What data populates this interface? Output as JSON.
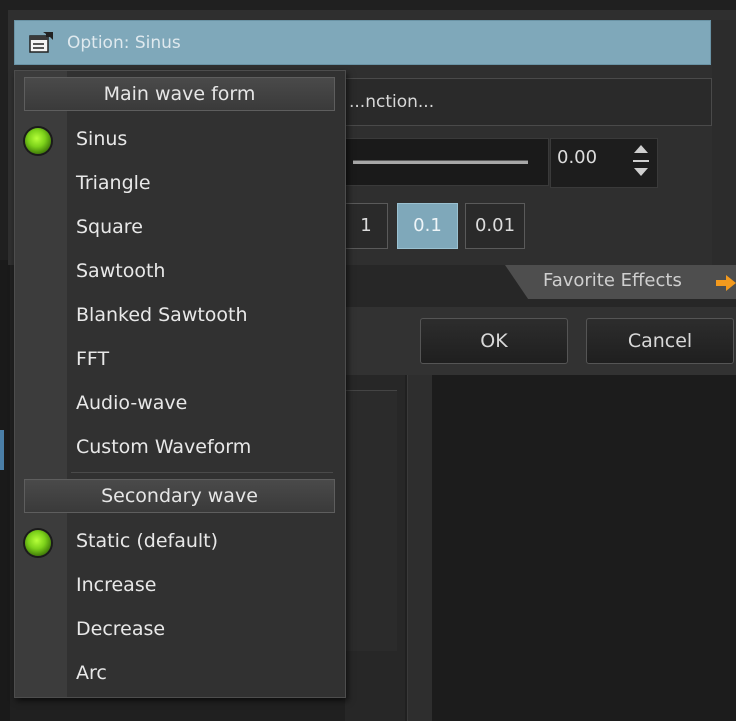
{
  "dialog": {
    "title": "Option: Sinus",
    "function_field": "...nction...",
    "value": "0.00",
    "steps": [
      "1",
      "0.1",
      "0.01"
    ],
    "favorite_tab": "Favorite Effects",
    "ok_label": "OK",
    "cancel_label": "Cancel"
  },
  "menu": {
    "main_header": "Main wave form",
    "main_items": [
      {
        "label": "Sinus",
        "selected": true
      },
      {
        "label": "Triangle",
        "selected": false
      },
      {
        "label": "Square",
        "selected": false
      },
      {
        "label": "Sawtooth",
        "selected": false
      },
      {
        "label": "Blanked Sawtooth",
        "selected": false
      },
      {
        "label": "FFT",
        "selected": false
      },
      {
        "label": "Audio-wave",
        "selected": false
      },
      {
        "label": "Custom Waveform",
        "selected": false
      }
    ],
    "secondary_header": "Secondary wave",
    "secondary_items": [
      {
        "label": "Static (default)",
        "selected": true
      },
      {
        "label": "Increase",
        "selected": false
      },
      {
        "label": "Decrease",
        "selected": false
      },
      {
        "label": "Arc",
        "selected": false
      }
    ]
  },
  "icons": {
    "dialog_icon": "properties-icon",
    "favorite_arrow": "arrow-right-icon",
    "radio": "green-radio-icon"
  },
  "colors": {
    "title_bar": "#7fa8ba",
    "selected_step": "#7fa8ba",
    "radio_green": "#7cd11a",
    "arrow_orange": "#f39a1e"
  }
}
